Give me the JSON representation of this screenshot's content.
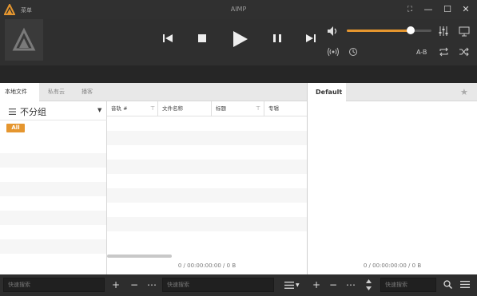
{
  "window": {
    "menu_label": "菜单",
    "title": "AIMP",
    "buttons": {
      "fullscreen": "⛶",
      "minimize": "—",
      "maximize": "☐",
      "close": "✕"
    }
  },
  "player": {
    "volume_percent": 75,
    "ab_label": "A-B",
    "accent_color": "#e5962f"
  },
  "library": {
    "tabs": [
      "本地文件",
      "私有云",
      "播客"
    ],
    "group_title": "不分组",
    "all_label": "All",
    "columns": [
      "音轨 #",
      "文件名称",
      "标题",
      "专辑"
    ],
    "status": "0 / 00:00:00:00 / 0 B"
  },
  "playlist": {
    "tab_label": "Default",
    "status": "0 / 00:00:00:00 / 0 B"
  },
  "bottom": {
    "search1_placeholder": "快速搜索",
    "search2_placeholder": "快速搜索",
    "search3_placeholder": "快速搜索"
  }
}
